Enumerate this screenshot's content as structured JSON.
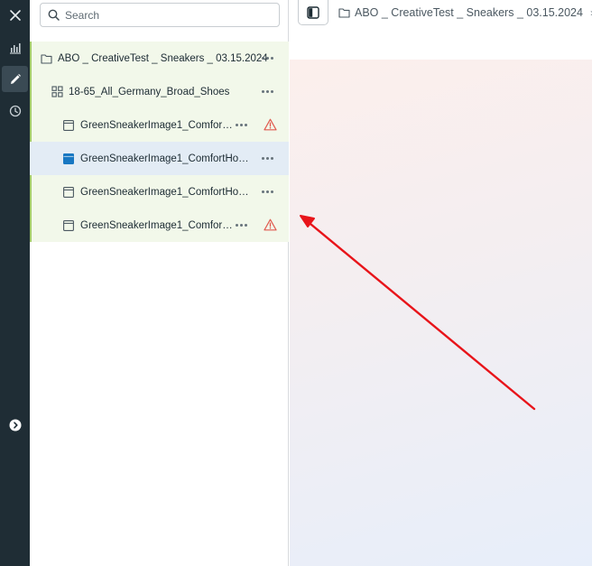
{
  "search": {
    "placeholder": "Search"
  },
  "tree": {
    "campaign": {
      "label": "ABO _ CreativeTest _ Sneakers _ 03.15.2024"
    },
    "adset": {
      "label": "18-65_All_Germany_Broad_Shoes"
    },
    "ads": [
      {
        "label": "GreenSneakerImage1_Comfor…",
        "warning": true,
        "selected": false
      },
      {
        "label": "GreenSneakerImage1_ComfortHook…",
        "warning": false,
        "selected": true
      },
      {
        "label": "GreenSneakerImage1_ComfortHook…",
        "warning": false,
        "selected": false
      },
      {
        "label": "GreenSneakerImage1_Comfor…",
        "warning": true,
        "selected": false
      }
    ]
  },
  "breadcrumb": {
    "label": "ABO _ CreativeTest _ Sneakers _ 03.15.2024",
    "separator": "›"
  },
  "colors": {
    "rail": "#1f2d35",
    "row_bg": "#f2f8ea",
    "selected_bg": "#e3ecf5",
    "accent_green": "#a4cc6a",
    "selected_icon": "#1877c2",
    "warning": "#e05a4f",
    "annotation_arrow": "#e8141a"
  },
  "icons": {
    "rail": [
      "close-icon",
      "bar-chart-icon",
      "pencil-icon",
      "clock-icon",
      "chevron-right-circle-icon"
    ],
    "search": "search-icon",
    "campaign": "folder-icon",
    "adset": "grid-icon",
    "ad": "ad-window-icon",
    "ad_selected": "ad-window-filled-icon",
    "more": "more-dots-icon",
    "warning": "warning-triangle-icon",
    "toggle": "sidebar-toggle-icon"
  }
}
